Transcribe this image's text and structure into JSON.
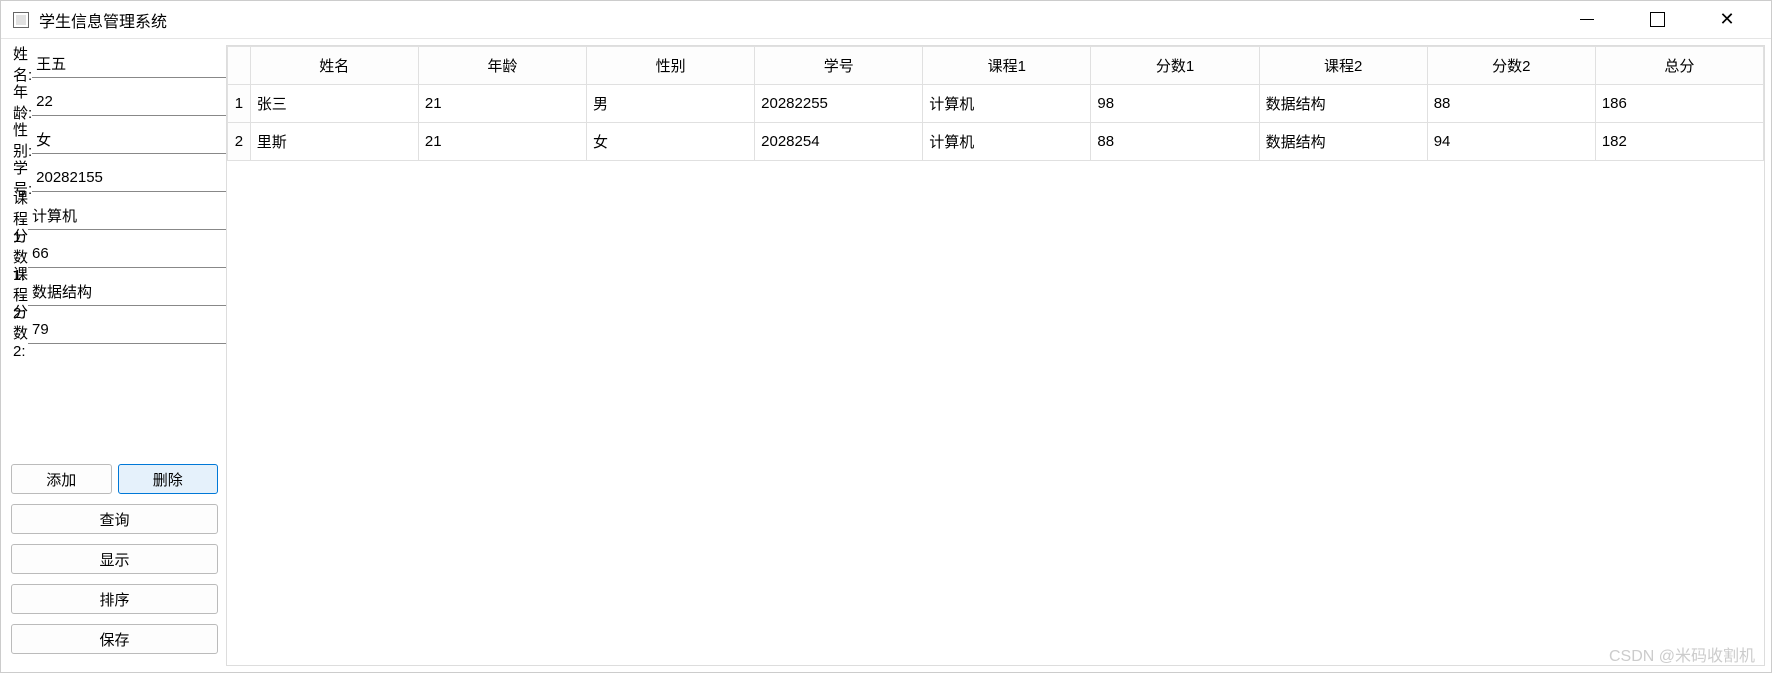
{
  "window": {
    "title": "学生信息管理系统"
  },
  "form": {
    "labels": {
      "name": "姓名:",
      "age": "年龄:",
      "gender": "性别:",
      "student_id": "学号:",
      "course1": "课程1:",
      "score1": "分数1:",
      "course2": "课程2:",
      "score2": "分数2:"
    },
    "values": {
      "name": "王五",
      "age": "22",
      "gender": "女",
      "student_id": "20282155",
      "course1": "计算机",
      "score1": "66",
      "course2": "数据结构",
      "score2": "79"
    }
  },
  "buttons": {
    "add": "添加",
    "delete": "删除",
    "query": "查询",
    "show": "显示",
    "sort": "排序",
    "save": "保存"
  },
  "table": {
    "headers": [
      "姓名",
      "年龄",
      "性别",
      "学号",
      "课程1",
      "分数1",
      "课程2",
      "分数2",
      "总分"
    ],
    "rows": [
      {
        "idx": "1",
        "name": "张三",
        "age": "21",
        "gender": "男",
        "student_id": "20282255",
        "course1": "计算机",
        "score1": "98",
        "course2": "数据结构",
        "score2": "88",
        "total": "186"
      },
      {
        "idx": "2",
        "name": "里斯",
        "age": "21",
        "gender": "女",
        "student_id": "2028254",
        "course1": "计算机",
        "score1": "88",
        "course2": "数据结构",
        "score2": "94",
        "total": "182"
      }
    ]
  },
  "watermark": "CSDN @米码收割机"
}
